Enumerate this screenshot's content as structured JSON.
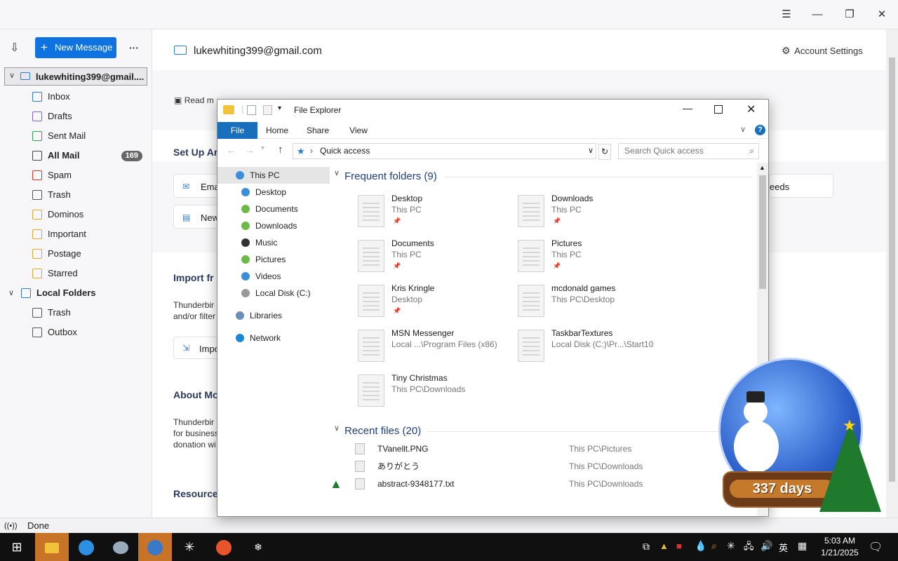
{
  "thunderbird": {
    "new_message": "New Message",
    "more": "···",
    "account": "lukewhiting399@gmail....",
    "account_header": "lukewhiting399@gmail.com",
    "account_settings": "Account Settings",
    "folders": [
      {
        "label": "Inbox",
        "icon": "inbox-icon",
        "color": "#2a7bd6"
      },
      {
        "label": "Drafts",
        "icon": "drafts-icon",
        "color": "#8a5cd6"
      },
      {
        "label": "Sent Mail",
        "icon": "sent-icon",
        "color": "#2aa34a"
      },
      {
        "label": "All Mail",
        "icon": "archive-icon",
        "color": "#444",
        "badge": "169"
      },
      {
        "label": "Spam",
        "icon": "spam-icon",
        "color": "#d9342b"
      },
      {
        "label": "Trash",
        "icon": "trash-icon",
        "color": "#555"
      },
      {
        "label": "Dominos",
        "icon": "folder-icon",
        "color": "#e3a82a"
      },
      {
        "label": "Important",
        "icon": "folder-icon",
        "color": "#e3a82a"
      },
      {
        "label": "Postage",
        "icon": "folder-icon",
        "color": "#e3a82a"
      },
      {
        "label": "Starred",
        "icon": "folder-icon",
        "color": "#e3a82a"
      }
    ],
    "local_folders": "Local Folders",
    "local_items": [
      {
        "label": "Trash",
        "icon": "trash-icon"
      },
      {
        "label": "Outbox",
        "icon": "outbox-icon"
      }
    ],
    "toolbar_read": "Read m",
    "setup_title": "Set Up Ar",
    "setup_email": "Ema",
    "setup_news": "New",
    "setup_feeds": "eeds",
    "import_title": "Import fr",
    "import_text_1": "Thunderbir",
    "import_text_2": "and/or filter",
    "import_btn": "Impo",
    "about_title": "About Mo",
    "about_text_1": "Thunderbir",
    "about_text_2": "for business",
    "about_text_3": "donation wi",
    "resources": "Resource",
    "status": "Done"
  },
  "explorer": {
    "title": "File Explorer",
    "tabs": {
      "file": "File",
      "home": "Home",
      "share": "Share",
      "view": "View"
    },
    "address": "Quick access",
    "search_placeholder": "Search Quick access",
    "nav": [
      {
        "label": "This PC",
        "color": "#3b8fd8"
      },
      {
        "label": "Desktop",
        "color": "#3b8fd8"
      },
      {
        "label": "Documents",
        "color": "#6cba4a"
      },
      {
        "label": "Downloads",
        "color": "#6cba4a"
      },
      {
        "label": "Music",
        "color": "#333"
      },
      {
        "label": "Pictures",
        "color": "#6cba4a"
      },
      {
        "label": "Videos",
        "color": "#3b8fd8"
      },
      {
        "label": "Local Disk (C:)",
        "color": "#999"
      },
      {
        "label": "Libraries",
        "color": "#6a8fb8"
      },
      {
        "label": "Network",
        "color": "#1e88d8"
      }
    ],
    "frequent_title": "Frequent folders (9)",
    "frequent": [
      {
        "name": "Desktop",
        "sub": "This PC"
      },
      {
        "name": "Downloads",
        "sub": "This PC"
      },
      {
        "name": "Documents",
        "sub": "This PC"
      },
      {
        "name": "Pictures",
        "sub": "This PC"
      },
      {
        "name": "Kris Kringle",
        "sub": "Desktop"
      },
      {
        "name": "mcdonald games",
        "sub": "This PC\\Desktop"
      },
      {
        "name": "MSN Messenger",
        "sub": "Local ...\\Program Files (x86)"
      },
      {
        "name": "TaskbarTextures",
        "sub": "Local Disk (C:)\\Pr...\\Start10"
      },
      {
        "name": "Tiny Christmas",
        "sub": "This PC\\Downloads"
      }
    ],
    "recent_title": "Recent files (20)",
    "recent": [
      {
        "name": "TVanellt.PNG",
        "loc": "This PC\\Pictures"
      },
      {
        "name": "ありがとう",
        "loc": "This PC\\Downloads"
      },
      {
        "name": "abstract-9348177.txt",
        "loc": "This PC\\Downloads"
      }
    ]
  },
  "globe": {
    "days": "337 days"
  },
  "taskbar": {
    "time": "5:03 AM",
    "date": "1/21/2025",
    "ime": "英"
  }
}
